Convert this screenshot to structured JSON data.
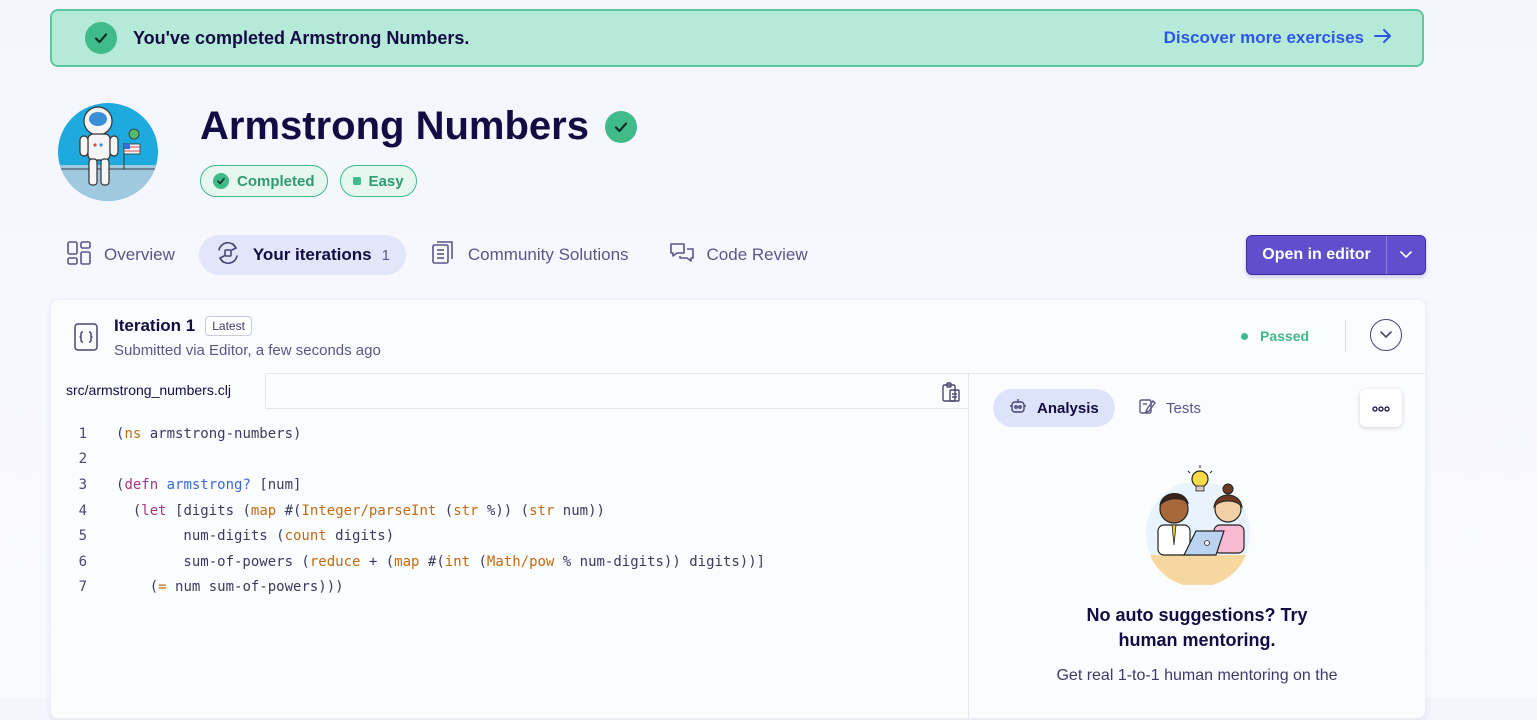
{
  "banner": {
    "message": "You've completed Armstrong Numbers.",
    "link": "Discover more exercises"
  },
  "exercise": {
    "title": "Armstrong Numbers",
    "tags": [
      "Completed",
      "Easy"
    ]
  },
  "tabs": [
    {
      "label": "Overview"
    },
    {
      "label": "Your iterations",
      "count": "1"
    },
    {
      "label": "Community Solutions"
    },
    {
      "label": "Code Review"
    }
  ],
  "open_editor": {
    "label": "Open in editor"
  },
  "iteration": {
    "title": "Iteration 1",
    "badge": "Latest",
    "subtitle": "Submitted via Editor, a few seconds ago",
    "status": "Passed"
  },
  "file": {
    "name": "src/armstrong_numbers.clj"
  },
  "code_lines": [
    "(ns armstrong-numbers)",
    "",
    "(defn armstrong? [num]",
    "  (let [digits (map #(Integer/parseInt (str %)) (str num))",
    "        num-digits (count digits)",
    "        sum-of-powers (reduce + (map #(int (Math/pow % num-digits)) digits))]",
    "    (= num sum-of-powers)))"
  ],
  "right_panel": {
    "tabs": [
      "Analysis",
      "Tests"
    ],
    "heading_line1": "No auto suggestions? Try",
    "heading_line2": "human mentoring.",
    "body": "Get real 1-to-1 human mentoring on the"
  },
  "colors": {
    "accent": "#604fcd",
    "success": "#3fba89",
    "banner_bg": "#b6ead8",
    "link": "#2e57e8"
  }
}
